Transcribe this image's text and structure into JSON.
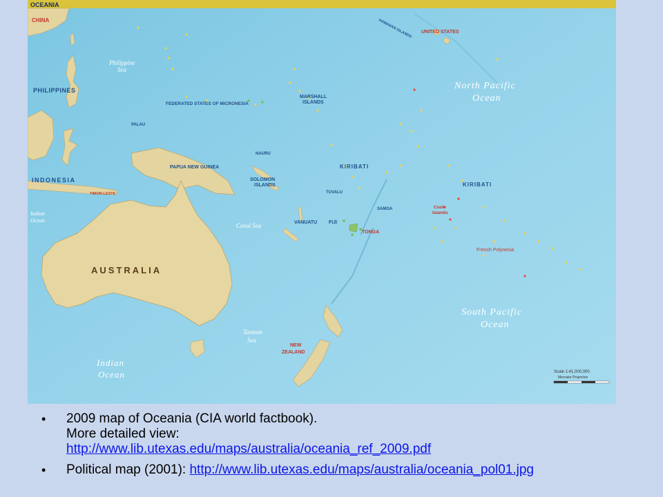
{
  "map": {
    "banner": "OCEANIA",
    "ocean_labels": {
      "north_pacific": [
        "North Pacific",
        "Ocean"
      ],
      "south_pacific": [
        "South Pacific",
        "Ocean"
      ],
      "indian_sw": [
        "Indian",
        "Ocean"
      ],
      "indian_w": [
        "Indian",
        "Ocean"
      ],
      "philippine_sea": [
        "Philippine",
        "Sea"
      ],
      "coral_sea": "Coral Sea",
      "tasman_sea": [
        "Tasman",
        "Sea"
      ]
    },
    "countries": {
      "china": "CHINA",
      "philippines": "PHILIPPINES",
      "indonesia": "INDONESIA",
      "australia": "AUSTRALIA",
      "png": "PAPUA NEW GUINEA",
      "micronesia": "FEDERATED STATES OF MICRONESIA",
      "marshall": [
        "MARSHALL",
        "ISLANDS"
      ],
      "kiribati_w": "KIRIBATI",
      "kiribati_e": "KIRIBATI",
      "solomon": [
        "SOLOMON",
        "ISLANDS"
      ],
      "vanuatu": "VANUATU",
      "fiji": "FIJI",
      "tonga": "TONGA",
      "samoa": "SAMOA",
      "tuvalu": "TUVALU",
      "new_zealand": [
        "NEW",
        "ZEALAND"
      ],
      "united_states": "UNITED STATES",
      "french_polynesia": "French Polynesia",
      "cook_islands": [
        "Cook",
        "Islands"
      ],
      "hawaiian": "HAWAIIAN ISLANDS",
      "palau": "PALAU",
      "nauru": "NAURU",
      "timor": "TIMOR-LESTE"
    },
    "scale": [
      "Scale 1:41,000,000",
      "Mercator Projection"
    ]
  },
  "bullets": [
    {
      "text_lines": [
        "2009 map of Oceania (CIA world factbook).",
        "More detailed view:"
      ],
      "link": "http://www.lib.utexas.edu/maps/australia/oceania_ref_2009.pdf"
    },
    {
      "prefix": "Political map (2001): ",
      "link": "http://www.lib.utexas.edu/maps/australia/oceania_pol01.jpg"
    }
  ],
  "colors": {
    "slide_bg": "#c9d7ee",
    "ocean": "#8fd0e8",
    "land": "#e8d9a6",
    "banner": "#d9c43c",
    "link": "#0a16e8"
  }
}
